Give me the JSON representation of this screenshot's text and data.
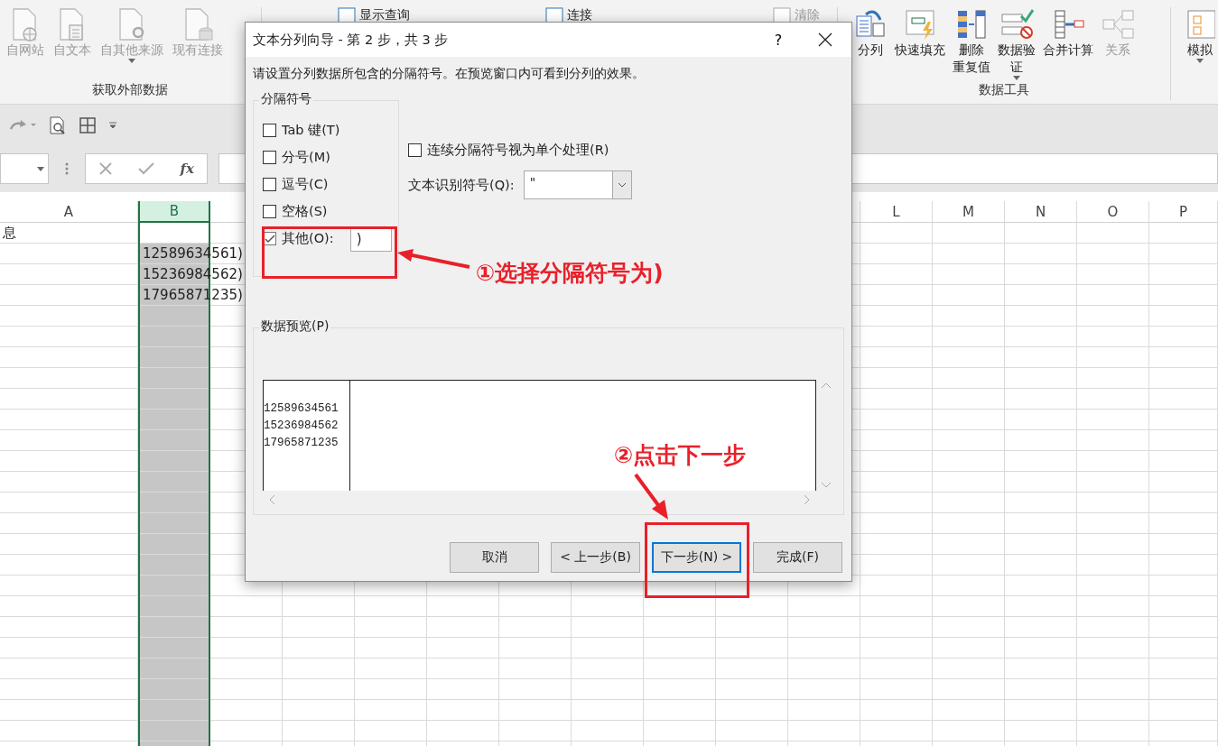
{
  "ribbon": {
    "left_group": {
      "label": "获取外部数据",
      "items": [
        {
          "lines": [
            "自网站"
          ],
          "disabled": true
        },
        {
          "lines": [
            "自文本"
          ],
          "disabled": true
        },
        {
          "lines": [
            "自其他来源"
          ],
          "disabled": true,
          "dropdown": true
        },
        {
          "lines": [
            "现有连接"
          ],
          "disabled": true
        }
      ]
    },
    "middle_items": [
      {
        "label": "显示查询",
        "disabled": false
      },
      {
        "label": "连接",
        "disabled": false
      },
      {
        "label": "清除",
        "disabled": true
      }
    ],
    "right_group": {
      "label": "数据工具",
      "items": [
        {
          "lines": [
            "分列"
          ],
          "disabled": false
        },
        {
          "lines": [
            "快速填充"
          ],
          "disabled": false
        },
        {
          "lines": [
            "删除",
            "重复值"
          ],
          "disabled": false
        },
        {
          "lines": [
            "数据验",
            "证"
          ],
          "disabled": false,
          "dropdown": true
        },
        {
          "lines": [
            "合并计算"
          ],
          "disabled": false
        },
        {
          "lines": [
            "关系"
          ],
          "disabled": true
        }
      ]
    },
    "cut_item": {
      "lines": [
        "模拟"
      ],
      "dropdown": true
    }
  },
  "formula_bar": {
    "function_label": "fx"
  },
  "sheet": {
    "columns": [
      {
        "label": "A",
        "selected": false
      },
      {
        "label": "B",
        "selected": true
      },
      {
        "label": "L",
        "selected": false
      },
      {
        "label": "M",
        "selected": false
      },
      {
        "label": "N",
        "selected": false
      },
      {
        "label": "O",
        "selected": false
      },
      {
        "label": "P",
        "selected": false
      }
    ],
    "rows": [
      {
        "col_a": "息"
      },
      {
        "col_b": "12589634561)"
      },
      {
        "col_b": "15236984562)"
      },
      {
        "col_b": "17965871235)"
      }
    ]
  },
  "dialog": {
    "title": "文本分列向导 - 第 2 步，共 3 步",
    "help": "?",
    "instruction": "请设置分列数据所包含的分隔符号。在预览窗口内可看到分列的效果。",
    "delimiters": {
      "label": "分隔符号",
      "options": [
        {
          "label": "Tab 键(T)",
          "checked": false
        },
        {
          "label": "分号(M)",
          "checked": false
        },
        {
          "label": "逗号(C)",
          "checked": false
        },
        {
          "label": "空格(S)",
          "checked": false
        },
        {
          "label": "其他(O):",
          "checked": true,
          "value": ")"
        }
      ]
    },
    "consecutive": {
      "label": "连续分隔符号视为单个处理(R)",
      "checked": false
    },
    "qualifier": {
      "label": "文本识别符号(Q):",
      "value": "\""
    },
    "preview": {
      "label": "数据预览(P)",
      "rows": [
        "12589634561",
        "15236984562",
        "17965871235"
      ]
    },
    "buttons": [
      {
        "label": "取消",
        "default": false
      },
      {
        "label": "< 上一步(B)",
        "default": false
      },
      {
        "label": "下一步(N) >",
        "default": true
      },
      {
        "label": "完成(F)",
        "default": false
      }
    ]
  },
  "annotations": [
    {
      "text": "①选择分隔符号为)"
    },
    {
      "text": "②点击下一步"
    }
  ]
}
